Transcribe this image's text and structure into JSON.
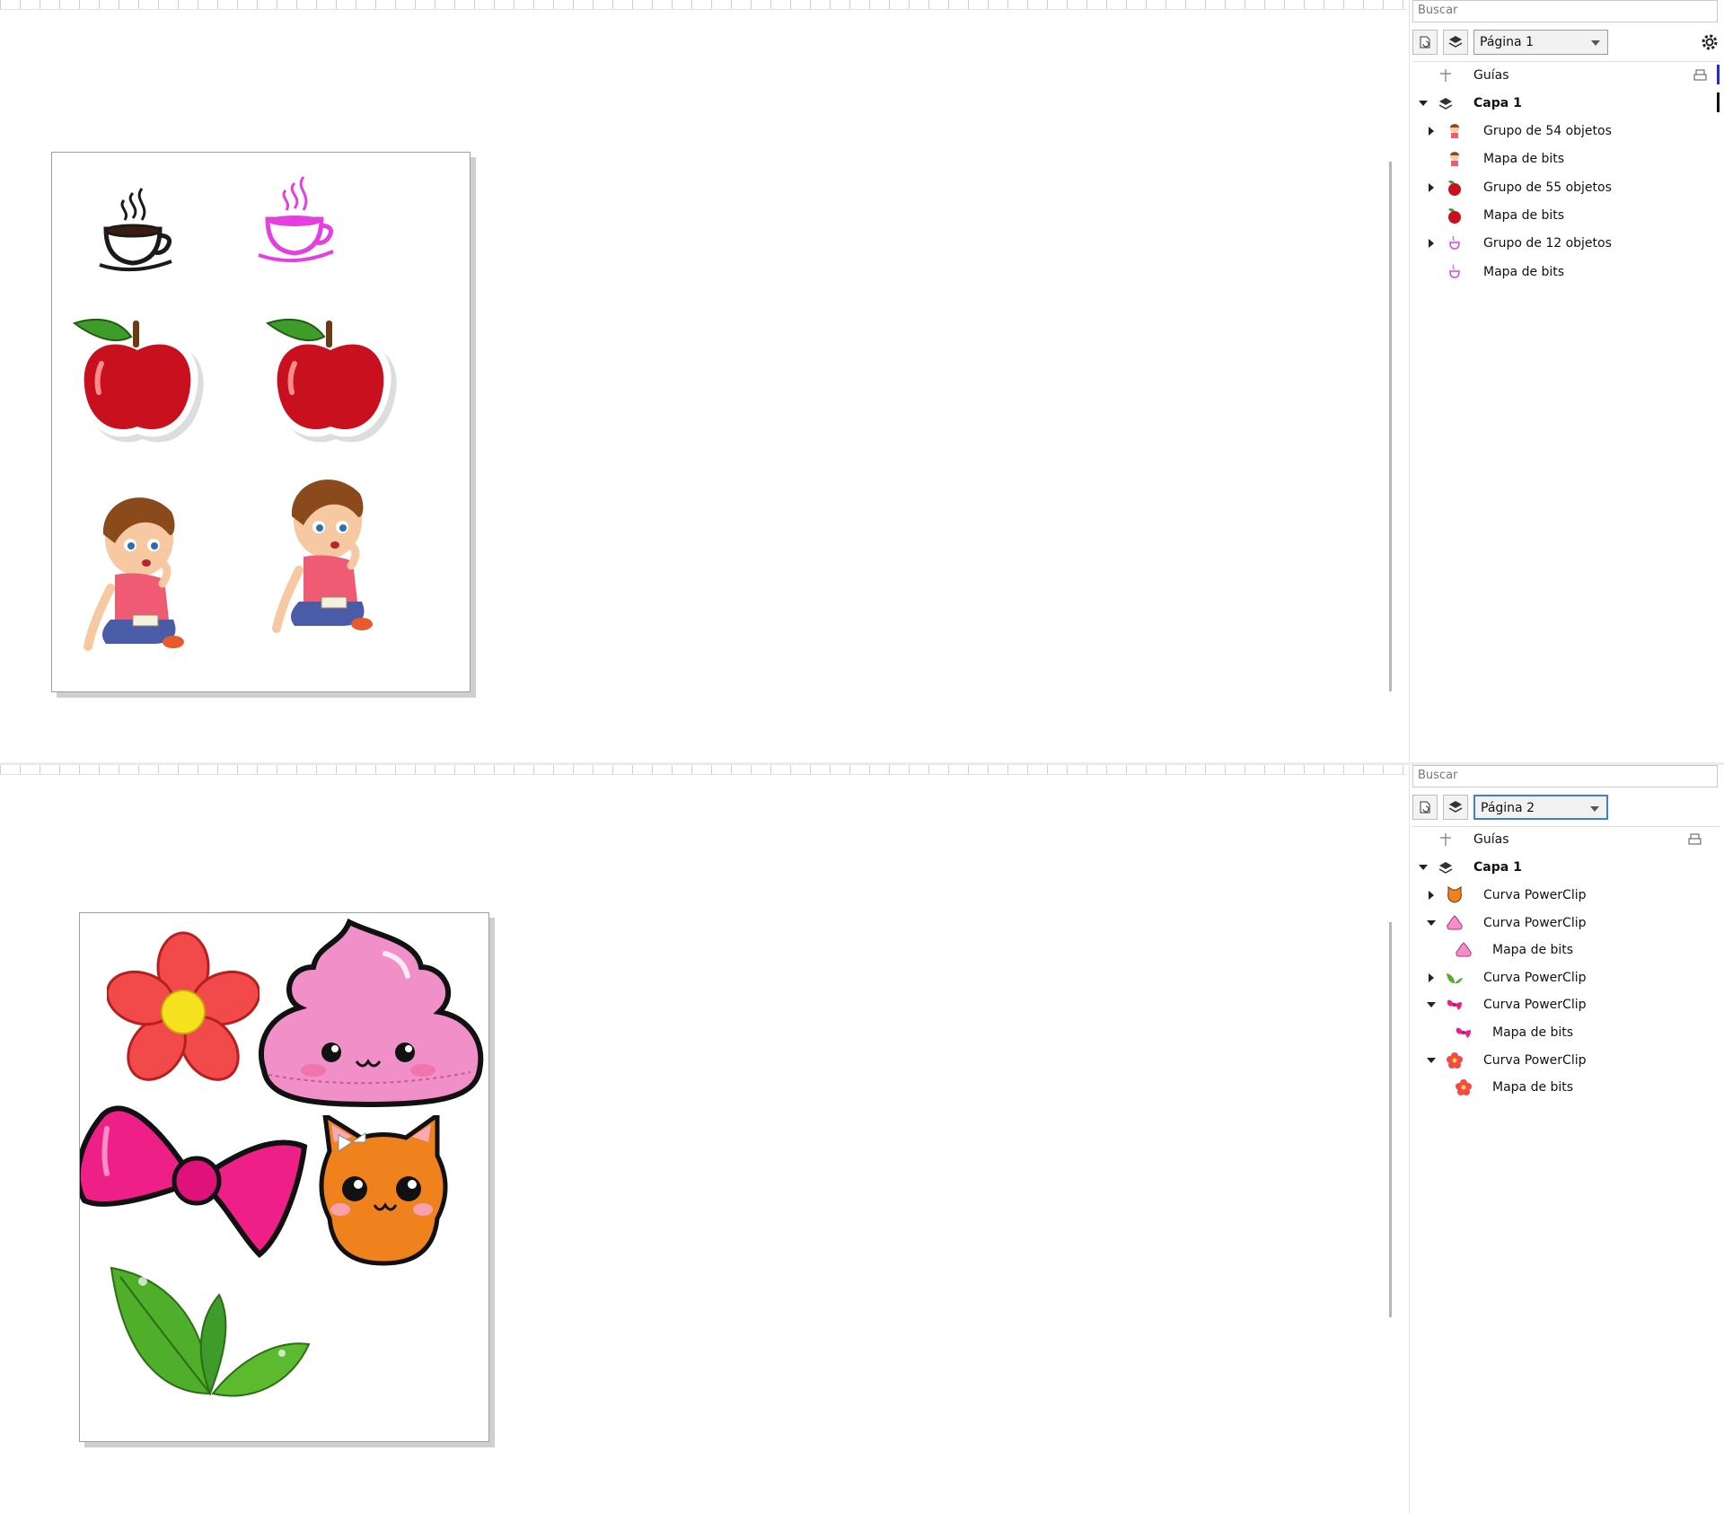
{
  "screen1": {
    "search_placeholder": "Buscar",
    "page_select": "Página 1",
    "guides_label": "Guías",
    "layer_label": "Capa 1",
    "objects": [
      {
        "label": "Grupo de 54 objetos",
        "icon": "boy-icon",
        "expandable": true
      },
      {
        "label": "Mapa de bits",
        "icon": "boy-icon",
        "expandable": false
      },
      {
        "label": "Grupo de 55 objetos",
        "icon": "apple-icon",
        "expandable": true
      },
      {
        "label": "Mapa de bits",
        "icon": "apple-icon",
        "expandable": false
      },
      {
        "label": "Grupo de 12 objetos",
        "icon": "cup-icon",
        "expandable": true
      },
      {
        "label": "Mapa de bits",
        "icon": "cup-icon",
        "expandable": false
      }
    ]
  },
  "screen2": {
    "search_placeholder": "Buscar",
    "page_select": "Página 2",
    "guides_label": "Guías",
    "layer_label": "Capa 1",
    "objects": [
      {
        "label": "Curva PowerClip",
        "icon": "cat-icon",
        "state": "collapsed",
        "indent": 0
      },
      {
        "label": "Curva PowerClip",
        "icon": "cream-icon",
        "state": "expanded",
        "indent": 0
      },
      {
        "label": "Mapa de bits",
        "icon": "cream-icon",
        "state": "none",
        "indent": 1
      },
      {
        "label": "Curva PowerClip",
        "icon": "leaf-icon",
        "state": "collapsed",
        "indent": 0
      },
      {
        "label": "Curva PowerClip",
        "icon": "bow-icon",
        "state": "expanded",
        "indent": 0
      },
      {
        "label": "Mapa de bits",
        "icon": "bow-icon",
        "state": "none",
        "indent": 1
      },
      {
        "label": "Curva PowerClip",
        "icon": "flower-icon",
        "state": "expanded",
        "indent": 0
      },
      {
        "label": "Mapa de bits",
        "icon": "flower-icon",
        "state": "none",
        "indent": 1
      }
    ]
  },
  "colors": {
    "apple_red": "#c8101e",
    "leaf_green": "#3f9b2a",
    "cup_magenta": "#e53fe0",
    "flower_red": "#f24a4a",
    "cream_pink": "#f08fc8",
    "bow_pink": "#ee1f86",
    "cat_orange": "#f0821e",
    "accent_blue": "#1b2fd6",
    "selected_border": "#3b7fd8"
  }
}
